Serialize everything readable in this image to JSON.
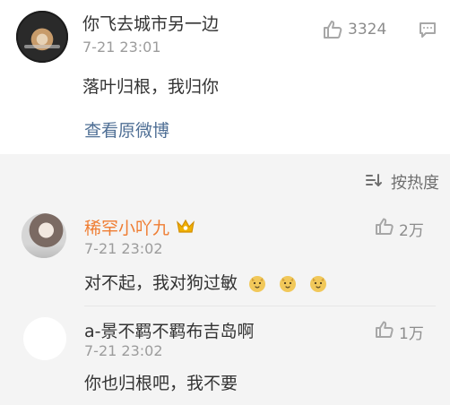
{
  "main_comment": {
    "username": "你飞去城市另一边",
    "timestamp": "7-21 23:01",
    "text": "落叶归根，我归你",
    "view_original": "查看原微博",
    "likes": "3324"
  },
  "sort": {
    "label": "按热度"
  },
  "replies": [
    {
      "username": "稀罕小吖九",
      "timestamp": "7-21 23:02",
      "text": "对不起，我对狗过敏",
      "likes": "2万",
      "username_color": "#ef7d32"
    },
    {
      "username": "a-景不羁不羁布吉岛啊",
      "timestamp": "7-21 23:02",
      "text": "你也归根吧，我不要",
      "likes": "1万",
      "username_color": "#333333"
    }
  ],
  "colors": {
    "link": "#4f6f95",
    "muted": "#9c9c9c",
    "accent_name": "#ef7d32",
    "crown": "#f0b000",
    "emoji_face": "#f1c85a"
  },
  "icons": {
    "like": "thumbs-up-icon",
    "comment": "comment-icon",
    "sort": "sort-icon",
    "crown": "crown-icon",
    "emoji": "dog-face-emoji"
  }
}
